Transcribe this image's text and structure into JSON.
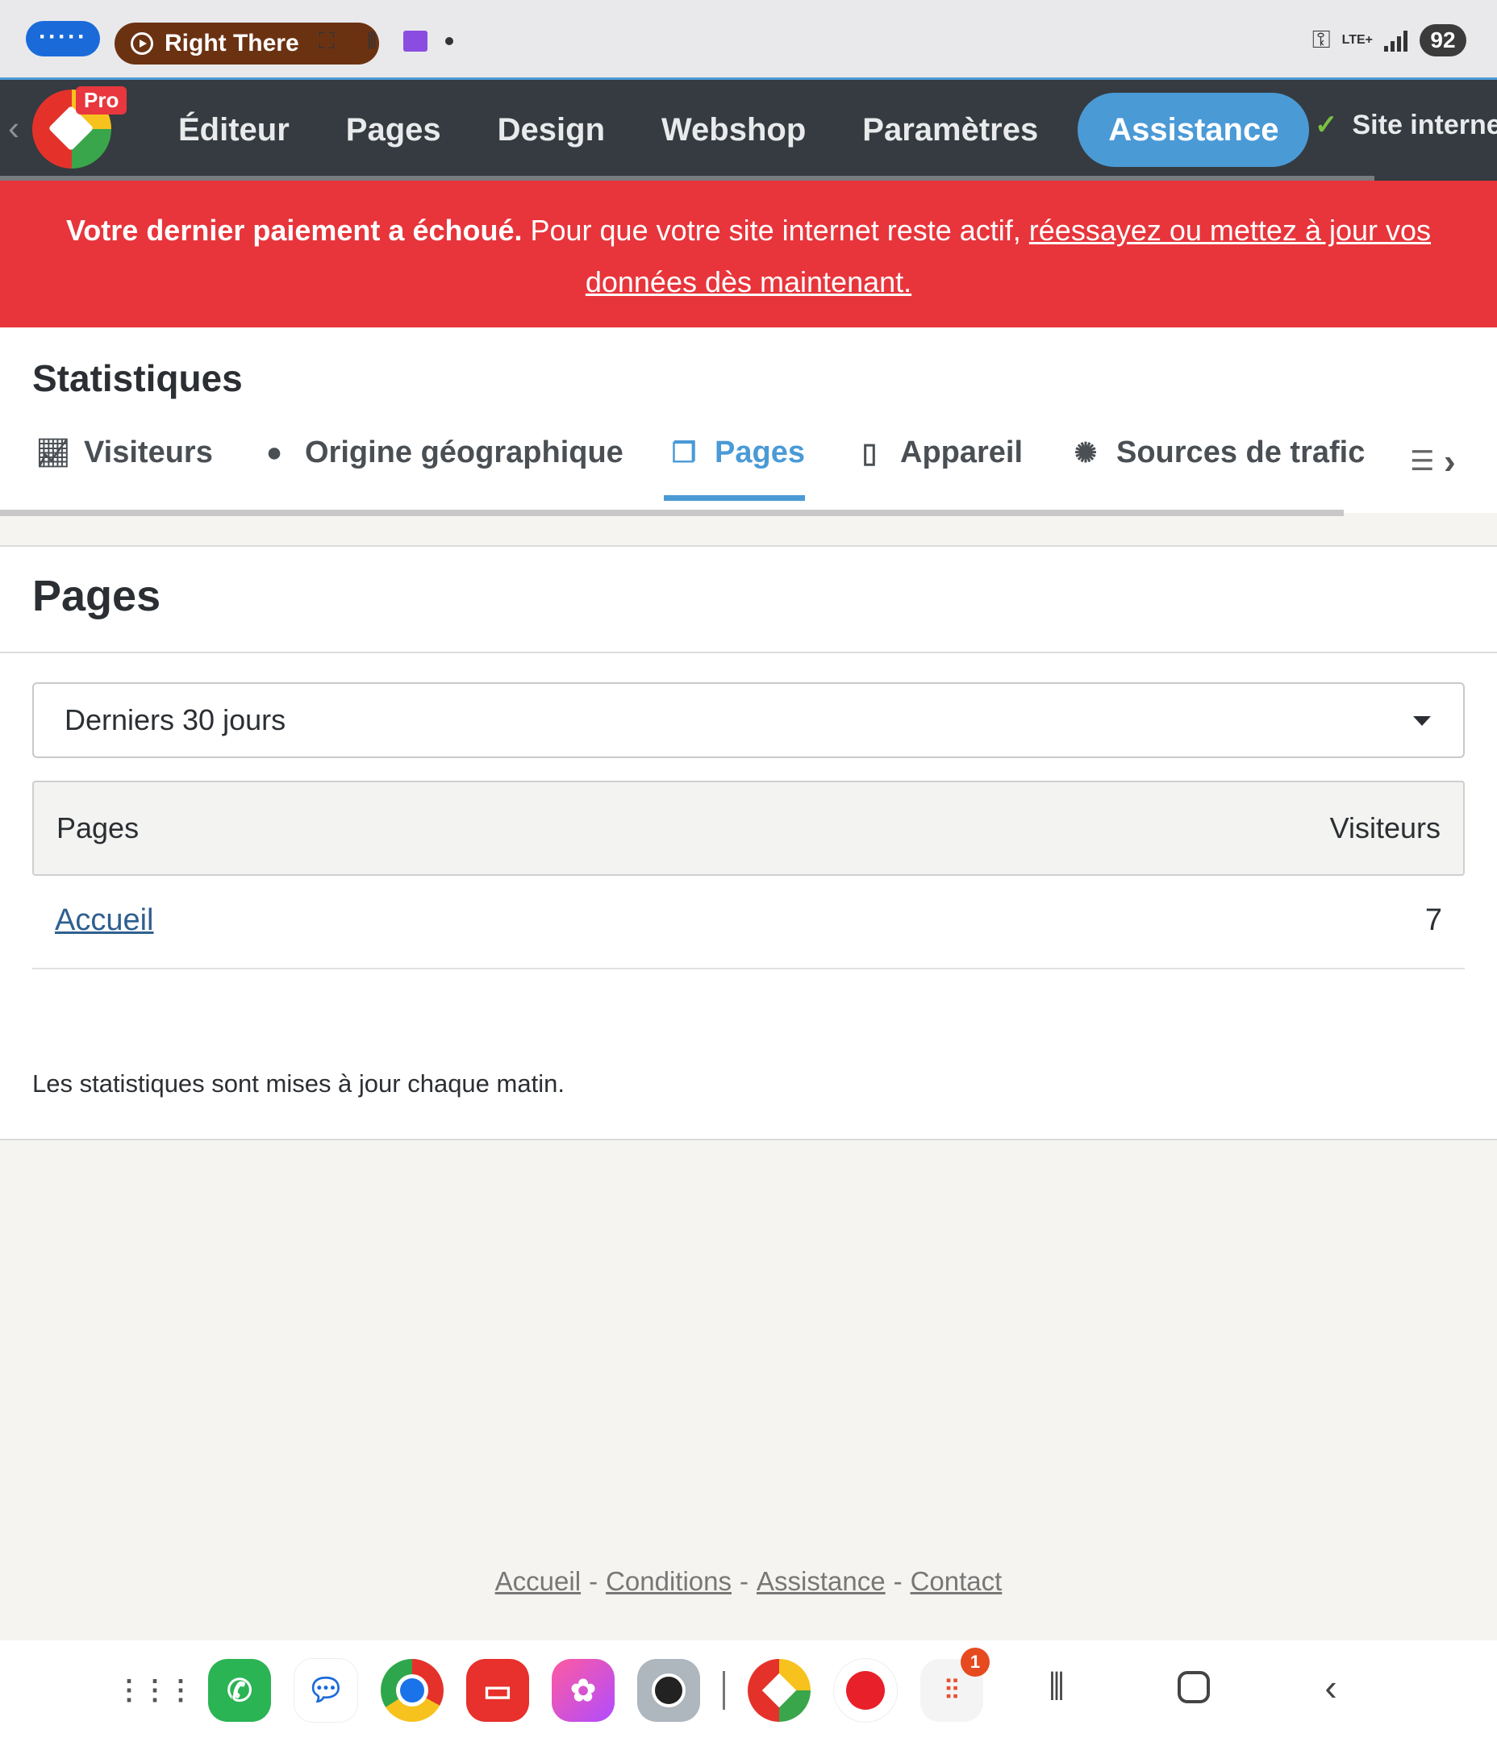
{
  "status_bar": {
    "pill_label": "·····",
    "media_title": "Right There",
    "icons": [
      "screenshot-icon",
      "audio-wave-icon",
      "purple-app-icon",
      "dot-icon"
    ],
    "battery": "92",
    "network": "LTE+"
  },
  "app_nav": {
    "badge": "Pro",
    "items": [
      {
        "label": "Éditeur"
      },
      {
        "label": "Pages"
      },
      {
        "label": "Design"
      },
      {
        "label": "Webshop"
      },
      {
        "label": "Paramètres"
      },
      {
        "label": "Assistance",
        "active": true
      }
    ],
    "site_status": "Site internet"
  },
  "alert": {
    "bold": "Votre dernier paiement a échoué.",
    "text": " Pour que votre site internet reste actif, ",
    "link": "réessayez ou mettez à jour vos données dès maintenant."
  },
  "stats": {
    "title": "Statistiques",
    "tabs": [
      {
        "label": "Visiteurs",
        "icon": "chart-line-icon"
      },
      {
        "label": "Origine géographique",
        "icon": "globe-icon"
      },
      {
        "label": "Pages",
        "icon": "pages-icon",
        "active": true
      },
      {
        "label": "Appareil",
        "icon": "mobile-icon"
      },
      {
        "label": "Sources de trafic",
        "icon": "traffic-icon"
      }
    ]
  },
  "main": {
    "title": "Pages",
    "period": "Derniers 30 jours",
    "table": {
      "headers": [
        "Pages",
        "Visiteurs"
      ],
      "rows": [
        {
          "page": "Accueil",
          "visitors": "7"
        }
      ]
    },
    "note": "Les statistiques sont mises à jour chaque matin."
  },
  "footer": {
    "links": [
      "Accueil",
      "Conditions",
      "Assistance",
      "Contact"
    ],
    "separator": "-"
  },
  "colors": {
    "accent": "#4a9ad6",
    "nav_bg": "#353b40",
    "alert_bg": "#e7353b"
  }
}
